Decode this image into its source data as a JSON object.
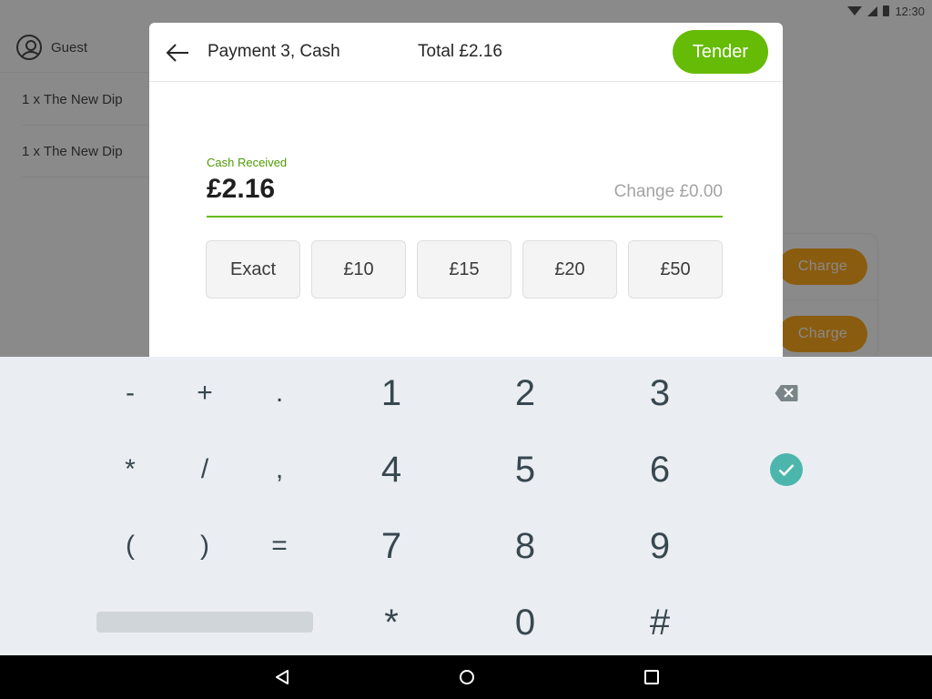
{
  "status_bar": {
    "time": "12:30",
    "icons": [
      "wifi-icon",
      "cell-signal-icon",
      "battery-icon"
    ]
  },
  "background": {
    "guest_label": "Guest",
    "order_items": [
      "1 x The New Dip",
      "1 x The New Dip"
    ],
    "charge_buttons": [
      "Charge",
      "Charge"
    ]
  },
  "modal": {
    "title": "Payment 3, Cash",
    "total": "Total £2.16",
    "tender_label": "Tender",
    "cash_received_label": "Cash Received",
    "cash_received_value": "£2.16",
    "change_text": "Change £0.00",
    "quick_amounts": [
      "Exact",
      "£10",
      "£15",
      "£20",
      "£50"
    ]
  },
  "keyboard": {
    "symbol_keys": [
      "-",
      "+",
      ".",
      "*",
      "/",
      ",",
      "(",
      ")",
      "="
    ],
    "number_keys": [
      "1",
      "2",
      "3",
      "4",
      "5",
      "6",
      "7",
      "8",
      "9",
      "*",
      "0",
      "#"
    ],
    "backspace_icon": "backspace-icon",
    "done_icon": "check-circle-icon"
  },
  "colors": {
    "accent_green": "#65bb05",
    "label_green": "#4f9a05",
    "done_teal": "#4db6ac",
    "charge_dimmed": "#8a5c10"
  },
  "nav_bar": {
    "icons": [
      "back-triangle-icon",
      "home-circle-icon",
      "recents-square-icon"
    ]
  }
}
